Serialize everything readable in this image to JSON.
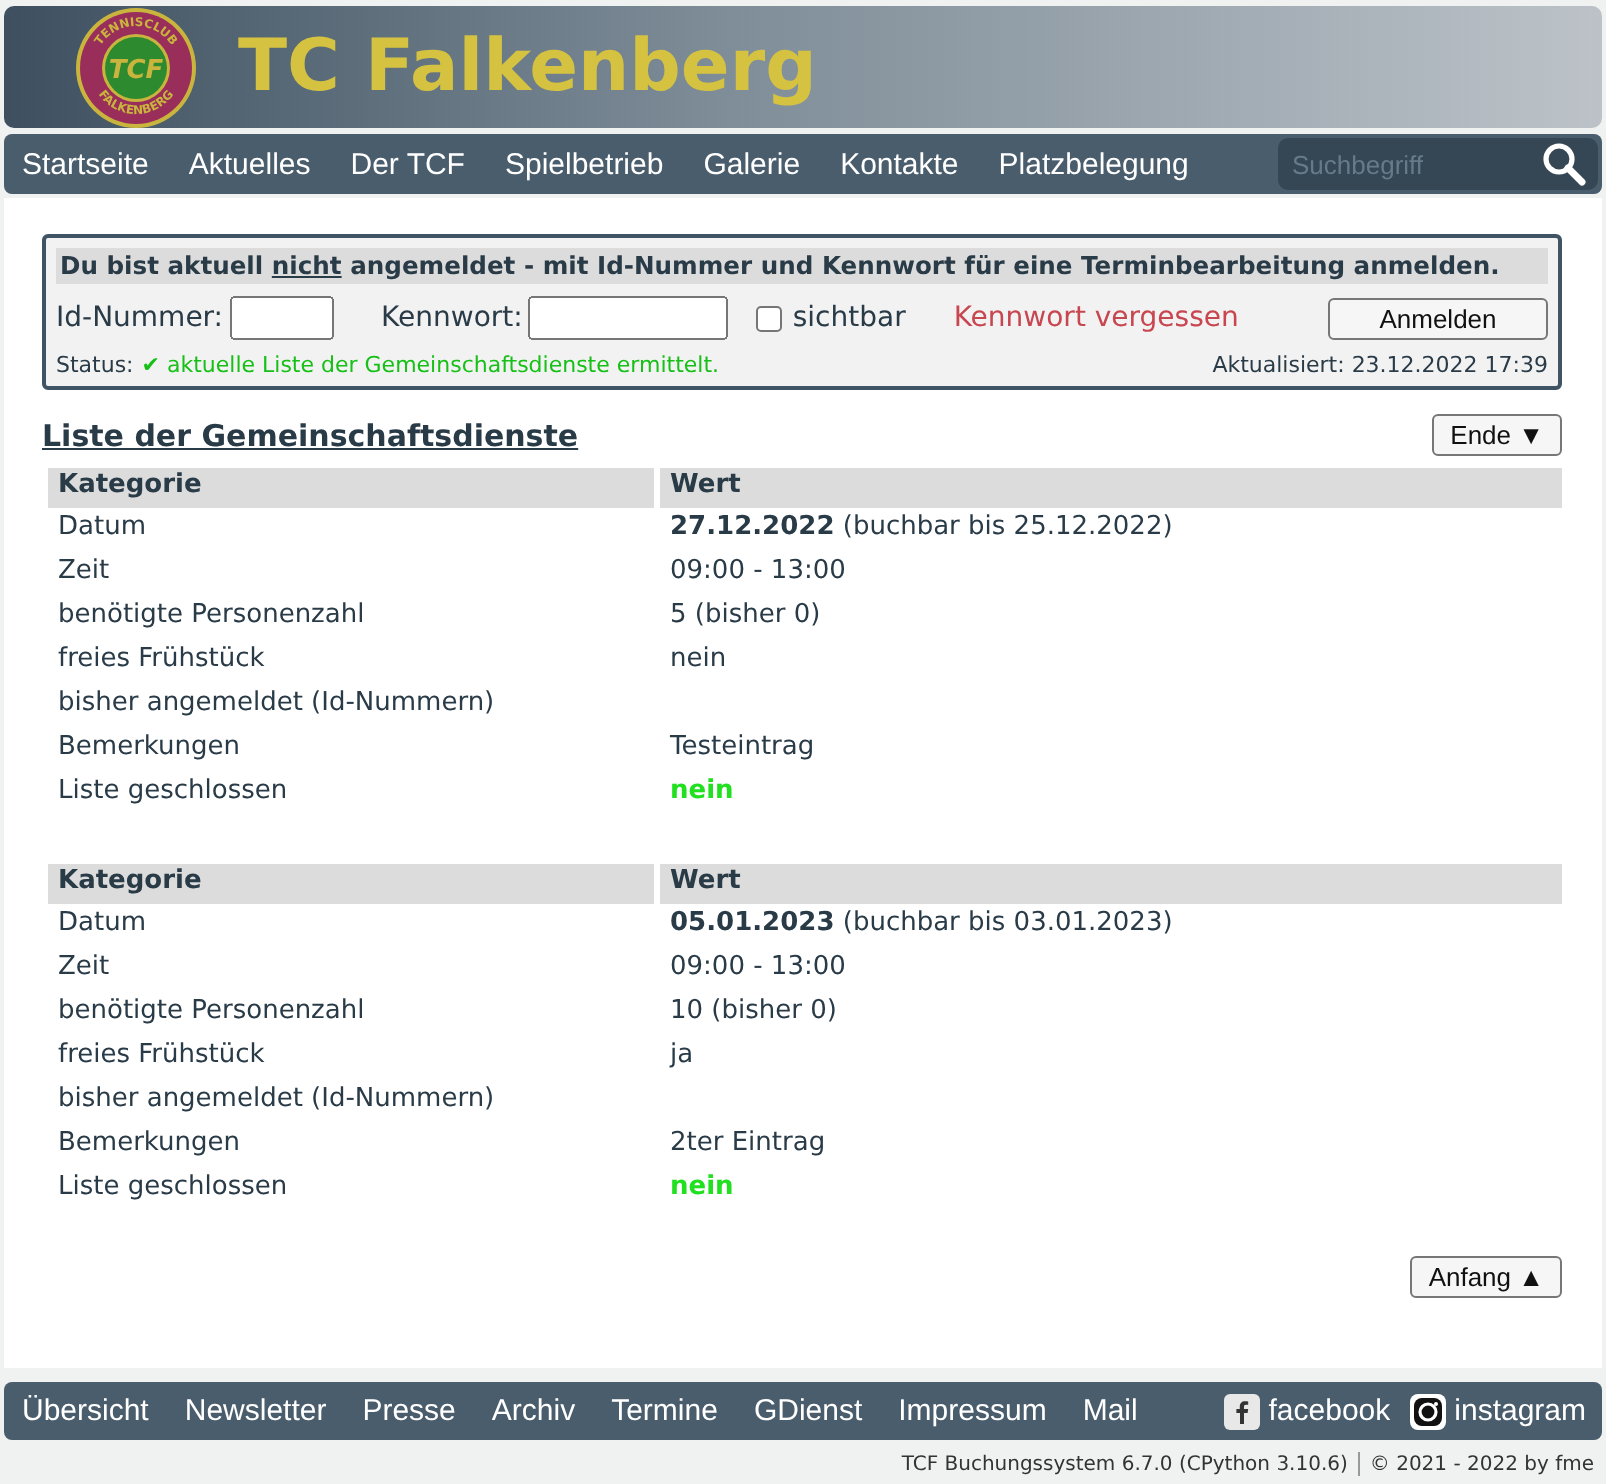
{
  "header": {
    "logo": {
      "ring_top": "TENNISCLUB",
      "center": "TCF",
      "ring_bottom": "FALKENBERG"
    },
    "title": "TC Falkenberg"
  },
  "nav": {
    "items": [
      "Startseite",
      "Aktuelles",
      "Der TCF",
      "Spielbetrieb",
      "Galerie",
      "Kontakte",
      "Platzbelegung"
    ],
    "search": {
      "placeholder": "Suchbegriff"
    }
  },
  "login": {
    "notice": [
      {
        "text": "Du bist aktuell ",
        "underline": false
      },
      {
        "text": "nicht",
        "underline": true
      },
      {
        "text": " angemeldet - mit Id-Nummer und Kennwort für eine Terminbearbeitung anmelden.",
        "underline": false
      }
    ],
    "id_label": "Id-Nummer:",
    "password_label": "Kennwort:",
    "show": {
      "label": "sichtbar",
      "checked": false
    },
    "forgot": "Kennwort vergessen",
    "submit": "Anmelden",
    "status_label": "Status:",
    "status_message": "✔ aktuelle Liste der Gemeinschaftsdienste ermittelt.",
    "updated": "Aktualisiert: 23.12.2022 17:39"
  },
  "list": {
    "title": "Liste der Gemeinschaftsdienste",
    "end_button": "Ende ▼",
    "start_button": "Anfang ▲",
    "tables": [
      {
        "columns": [
          "Kategorie",
          "Wert"
        ],
        "rows": [
          {
            "label": "Datum",
            "value": "**27.12.2022** (buchbar bis 25.12.2022)",
            "kind": "text"
          },
          {
            "label": "Zeit",
            "value": "09:00 - 13:00",
            "kind": "text"
          },
          {
            "label": "benötigte Personenzahl",
            "value": "5 (bisher 0)",
            "kind": "text"
          },
          {
            "label": "freies Frühstück",
            "value": "nein",
            "kind": "text"
          },
          {
            "label": "bisher angemeldet (Id-Nummern)",
            "kind": "text"
          },
          {
            "label": "Bemerkungen",
            "value": "Testeintrag",
            "kind": "text"
          },
          {
            "label": "Liste geschlossen",
            "value": "nein",
            "kind": "flag"
          }
        ]
      },
      {
        "columns": [
          "Kategorie",
          "Wert"
        ],
        "rows": [
          {
            "label": "Datum",
            "value": "**05.01.2023** (buchbar bis 03.01.2023)",
            "kind": "text"
          },
          {
            "label": "Zeit",
            "value": "09:00 - 13:00",
            "kind": "text"
          },
          {
            "label": "benötigte Personenzahl",
            "value": "10 (bisher 0)",
            "kind": "text"
          },
          {
            "label": "freies Frühstück",
            "value": "ja",
            "kind": "text"
          },
          {
            "label": "bisher angemeldet (Id-Nummern)",
            "kind": "text"
          },
          {
            "label": "Bemerkungen",
            "value": "2ter Eintrag",
            "kind": "text"
          },
          {
            "label": "Liste geschlossen",
            "value": "nein",
            "kind": "flag"
          }
        ]
      }
    ]
  },
  "footer": {
    "links": [
      "Übersicht",
      "Newsletter",
      "Presse",
      "Archiv",
      "Termine",
      "GDienst",
      "Impressum",
      "Mail"
    ],
    "social": [
      {
        "label": "facebook",
        "kind": "facebook"
      },
      {
        "label": "instagram",
        "kind": "instagram"
      }
    ],
    "version": "TCF Buchungssystem 6.7.0 (CPython 3.10.6)",
    "copyright": "© 2021 - 2022 by fme"
  }
}
